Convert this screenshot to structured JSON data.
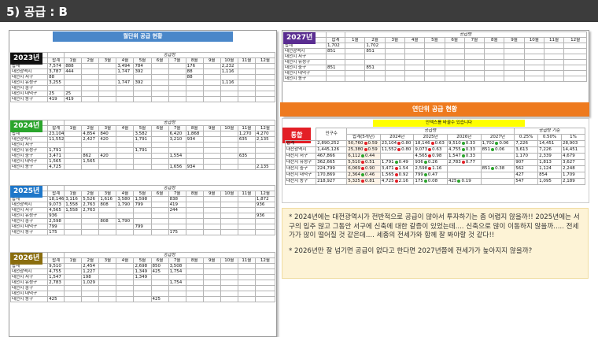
{
  "header": {
    "title": "5) 공급 : B"
  },
  "cols12": [
    "1월",
    "2월",
    "3월",
    "4월",
    "5월",
    "6월",
    "7월",
    "8월",
    "9월",
    "10월",
    "11월",
    "12월"
  ],
  "supply_caption": "공급량",
  "total_label": "합계",
  "regions": [
    "대전광역시",
    "대전시 서구",
    "대전시 유성구",
    "대전시 중구",
    "대전시 대덕구",
    "대전시 동구"
  ],
  "monthly": {
    "title": "월단위 공급 현황",
    "years": [
      {
        "badge": "2023년",
        "color": "#111111",
        "total": [
          "7,574",
          "888",
          "",
          "",
          "3,494",
          "784",
          "",
          "",
          "176",
          "",
          "2,232",
          "",
          ""
        ],
        "rows": [
          [
            "3,787",
            "444",
            "",
            "",
            "1,747",
            "392",
            "",
            "",
            "88",
            "",
            "1,116",
            "",
            ""
          ],
          [
            "88",
            "",
            "",
            "",
            "",
            "",
            "",
            "",
            "88",
            "",
            "",
            "",
            ""
          ],
          [
            "3,255",
            "",
            "",
            "",
            "1,747",
            "392",
            "",
            "",
            "",
            "",
            "1,116",
            "",
            ""
          ],
          [
            "",
            "",
            "",
            "",
            "",
            "",
            "",
            "",
            "",
            "",
            "",
            "",
            ""
          ],
          [
            "25",
            "25",
            "",
            "",
            "",
            "",
            "",
            "",
            "",
            "",
            "",
            "",
            ""
          ],
          [
            "419",
            "419",
            "",
            "",
            "",
            "",
            "",
            "",
            "",
            "",
            "",
            "",
            ""
          ]
        ]
      },
      {
        "badge": "2024년",
        "color": "#2aa52c",
        "total": [
          "23,104",
          "",
          "4,854",
          "840",
          "",
          "3,582",
          "",
          "6,420",
          "1,868",
          "",
          "",
          "1,270",
          "4,270"
        ],
        "rows": [
          [
            "11,552",
            "",
            "2,427",
            "420",
            "",
            "1,791",
            "",
            "3,210",
            "934",
            "",
            "",
            "635",
            "2,135"
          ],
          [
            "",
            "",
            "",
            "",
            "",
            "",
            "",
            "",
            "",
            "",
            "",
            "",
            ""
          ],
          [
            "1,791",
            "",
            "",
            "",
            "",
            "1,791",
            "",
            "",
            "",
            "",
            "",
            "",
            ""
          ],
          [
            "3,471",
            "",
            "862",
            "420",
            "",
            "",
            "",
            "1,554",
            "",
            "",
            "",
            "635",
            ""
          ],
          [
            "1,565",
            "",
            "1,565",
            "",
            "",
            "",
            "",
            "",
            "",
            "",
            "",
            "",
            ""
          ],
          [
            "4,725",
            "",
            "",
            "",
            "",
            "",
            "",
            "1,656",
            "934",
            "",
            "",
            "",
            "2,135"
          ]
        ]
      },
      {
        "badge": "2025년",
        "color": "#1f77c9",
        "total": [
          "18,146",
          "3,116",
          "5,526",
          "1,616",
          "3,580",
          "1,598",
          "",
          "838",
          "",
          "",
          "",
          "",
          "1,872"
        ],
        "rows": [
          [
            "9,073",
            "1,558",
            "2,763",
            "808",
            "1,790",
            "799",
            "",
            "419",
            "",
            "",
            "",
            "",
            "936"
          ],
          [
            "4,565",
            "1,558",
            "2,763",
            "",
            "",
            "",
            "",
            "244",
            "",
            "",
            "",
            "",
            ""
          ],
          [
            "936",
            "",
            "",
            "",
            "",
            "",
            "",
            "",
            "",
            "",
            "",
            "",
            "936"
          ],
          [
            "2,598",
            "",
            "",
            "808",
            "1,790",
            "",
            "",
            "",
            "",
            "",
            "",
            "",
            ""
          ],
          [
            "799",
            "",
            "",
            "",
            "",
            "799",
            "",
            "",
            "",
            "",
            "",
            "",
            ""
          ],
          [
            "175",
            "",
            "",
            "",
            "",
            "",
            "",
            "175",
            "",
            "",
            "",
            "",
            ""
          ]
        ]
      },
      {
        "badge": "2026년",
        "color": "#8a6d0e",
        "total": [
          "9,510",
          "",
          "2,454",
          "",
          "",
          "2,698",
          "850",
          "3,508",
          "",
          "",
          "",
          "",
          ""
        ],
        "rows": [
          [
            "4,755",
            "",
            "1,227",
            "",
            "",
            "1,349",
            "425",
            "1,754",
            "",
            "",
            "",
            "",
            ""
          ],
          [
            "1,547",
            "",
            "198",
            "",
            "",
            "1,349",
            "",
            "",
            "",
            "",
            "",
            "",
            ""
          ],
          [
            "2,783",
            "",
            "1,029",
            "",
            "",
            "",
            "",
            "1,754",
            "",
            "",
            "",
            "",
            ""
          ],
          [
            "",
            "",
            "",
            "",
            "",
            "",
            "",
            "",
            "",
            "",
            "",
            "",
            ""
          ],
          [
            "",
            "",
            "",
            "",
            "",
            "",
            "",
            "",
            "",
            "",
            "",
            "",
            ""
          ],
          [
            "425",
            "",
            "",
            "",
            "",
            "",
            "425",
            "",
            "",
            "",
            "",
            "",
            ""
          ]
        ]
      },
      {
        "badge": "2027년",
        "color": "#5a2d91",
        "total": [
          "1,702",
          "",
          "1,702",
          "",
          "",
          "",
          "",
          "",
          "",
          "",
          "",
          "",
          ""
        ],
        "rows": [
          [
            "851",
            "",
            "851",
            "",
            "",
            "",
            "",
            "",
            "",
            "",
            "",
            "",
            ""
          ],
          [
            "",
            "",
            "",
            "",
            "",
            "",
            "",
            "",
            "",
            "",
            "",
            "",
            ""
          ],
          [
            "",
            "",
            "",
            "",
            "",
            "",
            "",
            "",
            "",
            "",
            "",
            "",
            ""
          ],
          [
            "851",
            "",
            "851",
            "",
            "",
            "",
            "",
            "",
            "",
            "",
            "",
            "",
            ""
          ],
          [
            "",
            "",
            "",
            "",
            "",
            "",
            "",
            "",
            "",
            "",
            "",
            "",
            ""
          ],
          [
            "",
            "",
            "",
            "",
            "",
            "",
            "",
            "",
            "",
            "",
            "",
            "",
            ""
          ]
        ]
      }
    ]
  },
  "yearly": {
    "title": "연단위 공급 현황",
    "tonghap": "통합",
    "note": "인덱스를 바꿀수 있습니다",
    "pop_label": "인구수",
    "supply_label": "공급량",
    "basis_label": "공급량 기준",
    "sub_headers": [
      "합계(5개년)",
      "2024년",
      "2025년",
      "2026년",
      "2027년",
      "0.25%",
      "0.50%",
      "1%"
    ],
    "rows": [
      {
        "name": "합계",
        "pop": "2,890,252",
        "sum": "50,760",
        "sumr": "0.59",
        "sumc": "#e31f26",
        "y": [
          [
            "23,104",
            "0.80",
            "#e31f26"
          ],
          [
            "18,146",
            "0.63",
            "#e31f26"
          ],
          [
            "9,510",
            "0.33",
            "#2aa52c"
          ],
          [
            "1,702",
            "0.06",
            "#2aa52c"
          ]
        ],
        "b": [
          "7,226",
          "14,451",
          "28,903"
        ]
      },
      {
        "name": "대전광역시",
        "pop": "1,445,126",
        "sum": "25,380",
        "sumr": "0.59",
        "sumc": "#e31f26",
        "y": [
          [
            "11,552",
            "0.80",
            "#e31f26"
          ],
          [
            "9,073",
            "0.63",
            "#e31f26"
          ],
          [
            "4,755",
            "0.33",
            "#2aa52c"
          ],
          [
            "851",
            "0.06",
            "#2aa52c"
          ]
        ],
        "b": [
          "3,613",
          "7,226",
          "14,451"
        ]
      },
      {
        "name": "대전시 서구",
        "pop": "467,866",
        "sum": "6,112",
        "sumr": "0.44",
        "sumc": "#2aa52c",
        "y": [
          [
            "",
            "",
            ""
          ],
          [
            "4,565",
            "0.98",
            "#e31f26"
          ],
          [
            "1,547",
            "0.33",
            "#2aa52c"
          ],
          [
            "",
            "",
            ""
          ]
        ],
        "b": [
          "1,170",
          "2,339",
          "4,679"
        ]
      },
      {
        "name": "대전시 유성구",
        "pop": "362,665",
        "sum": "5,510",
        "sumr": "0.51",
        "sumc": "#e31f26",
        "y": [
          [
            "1,791",
            "0.49",
            "#2aa52c"
          ],
          [
            "936",
            "0.26",
            "#2aa52c"
          ],
          [
            "2,783",
            "0.77",
            "#e31f26"
          ],
          [
            "",
            "",
            ""
          ]
        ],
        "b": [
          "907",
          "1,813",
          "3,627"
        ]
      },
      {
        "name": "대전시 중구",
        "pop": "224,799",
        "sum": "6,069",
        "sumr": "0.90",
        "sumc": "#e31f26",
        "y": [
          [
            "3,471",
            "1.54",
            "#e31f26"
          ],
          [
            "2,598",
            "1.16",
            "#e31f26"
          ],
          [
            "",
            "",
            ""
          ],
          [
            "851",
            "0.38",
            "#2aa52c"
          ]
        ],
        "b": [
          "562",
          "1,124",
          "2,248"
        ]
      },
      {
        "name": "대전시 대덕구",
        "pop": "170,869",
        "sum": "2,364",
        "sumr": "0.46",
        "sumc": "#2aa52c",
        "y": [
          [
            "1,565",
            "0.92",
            "#e31f26"
          ],
          [
            "799",
            "0.47",
            "#2aa52c"
          ],
          [
            "",
            "",
            ""
          ],
          [
            "",
            "",
            ""
          ]
        ],
        "b": [
          "427",
          "854",
          "1,709"
        ]
      },
      {
        "name": "대전시 동구",
        "pop": "218,927",
        "sum": "5,325",
        "sumr": "0.81",
        "sumc": "#e31f26",
        "y": [
          [
            "4,725",
            "2.16",
            "#e31f26"
          ],
          [
            "175",
            "0.08",
            "#2aa52c"
          ],
          [
            "425",
            "0.19",
            "#2aa52c"
          ],
          [
            "",
            "",
            ""
          ]
        ],
        "b": [
          "547",
          "1,095",
          "2,189"
        ]
      }
    ]
  },
  "notes": [
    "* 2024년에는 대전광역시가 전반적으로 공급이 많아서 투자하기는 좀 어렵지 않을까!! 2025년에는 서구의 입주 많고 그동안 서구에 신축에 대한 갈증이 있었는데.... 신축으로 많이 이동하지 않을까..... 전세가가 많이 떨어질 것 같은데.... 세종의 전세가와 함께 잘 봐야할 것 같다!!",
    "* 2026년만 잘 넘기면 공급이 없다고 한다면 2027년쯤에 전세가가 높아지지 않을까?"
  ]
}
